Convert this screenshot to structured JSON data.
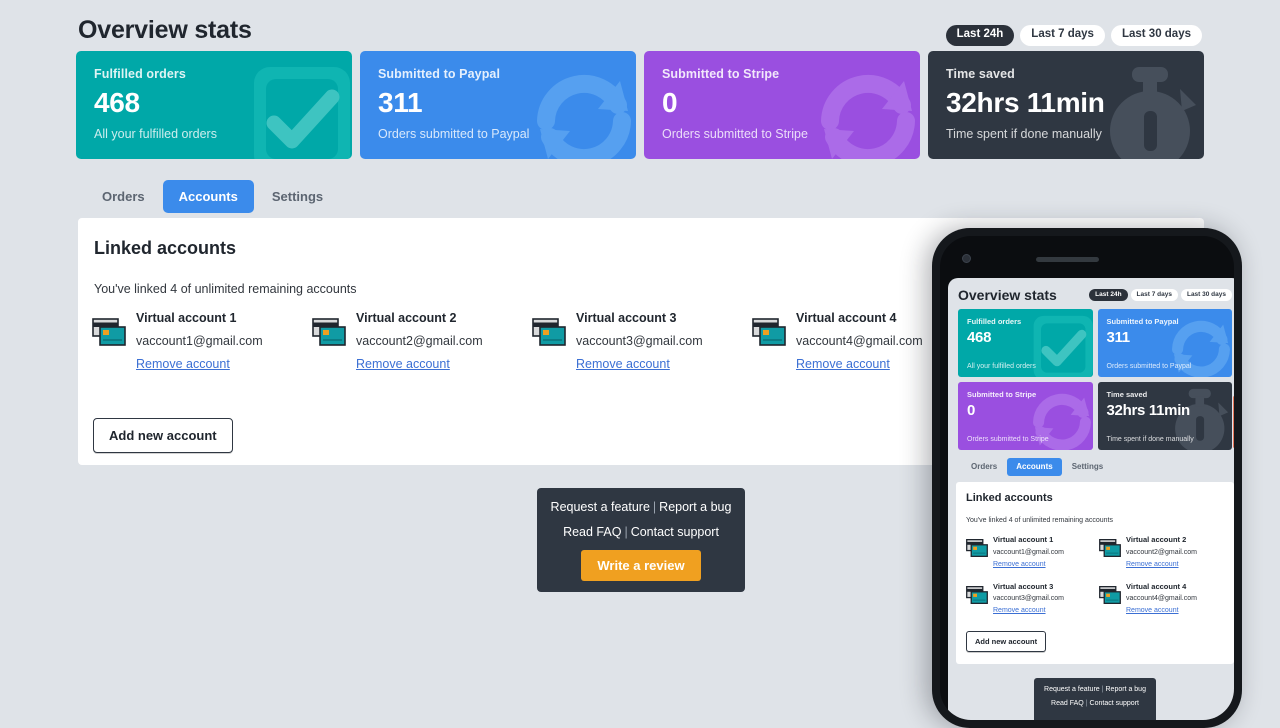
{
  "header": {
    "title": "Overview stats",
    "ranges": [
      {
        "label": "Last 24h",
        "active": true
      },
      {
        "label": "Last 7 days",
        "active": false
      },
      {
        "label": "Last 30 days",
        "active": false
      }
    ]
  },
  "stats": [
    {
      "label": "Fulfilled orders",
      "value": "468",
      "sub": "All your fulfilled orders",
      "color": "#00a8a8",
      "watermark": "check-square-icon"
    },
    {
      "label": "Submitted to Paypal",
      "value": "311",
      "sub": "Orders submitted to Paypal",
      "color": "#3b8beb",
      "watermark": "sync-arrows-icon"
    },
    {
      "label": "Submitted to Stripe",
      "value": "0",
      "sub": "Orders submitted to Stripe",
      "color": "#9a4fe0",
      "watermark": "sync-arrows-icon"
    },
    {
      "label": "Time saved",
      "value": "32hrs 11min",
      "sub": "Time spent if done manually",
      "color": "#2f3742",
      "watermark": "stopwatch-icon"
    }
  ],
  "tabs": [
    {
      "label": "Orders",
      "active": false
    },
    {
      "label": "Accounts",
      "active": true
    },
    {
      "label": "Settings",
      "active": false
    }
  ],
  "panel": {
    "title": "Linked accounts",
    "subtitle": "You've linked 4 of unlimited remaining accounts",
    "remove_label": "Remove account",
    "add_button": "Add new account",
    "accounts": [
      {
        "name": "Virtual account 1",
        "email": "vaccount1@gmail.com"
      },
      {
        "name": "Virtual account 2",
        "email": "vaccount2@gmail.com"
      },
      {
        "name": "Virtual account 3",
        "email": "vaccount3@gmail.com"
      },
      {
        "name": "Virtual account 4",
        "email": "vaccount4@gmail.com"
      }
    ]
  },
  "footer": {
    "request_feature": "Request a feature",
    "report_bug": "Report a bug",
    "read_faq": "Read FAQ",
    "contact_support": "Contact support",
    "separator": "|",
    "review_button": "Write a review",
    "review_color": "#f0a020"
  },
  "colors": {
    "page_background": "#dfe3e8",
    "panel_background": "#ffffff",
    "accent_blue": "#3b8beb",
    "dark": "#2f3742",
    "link": "#3b6fd4"
  }
}
